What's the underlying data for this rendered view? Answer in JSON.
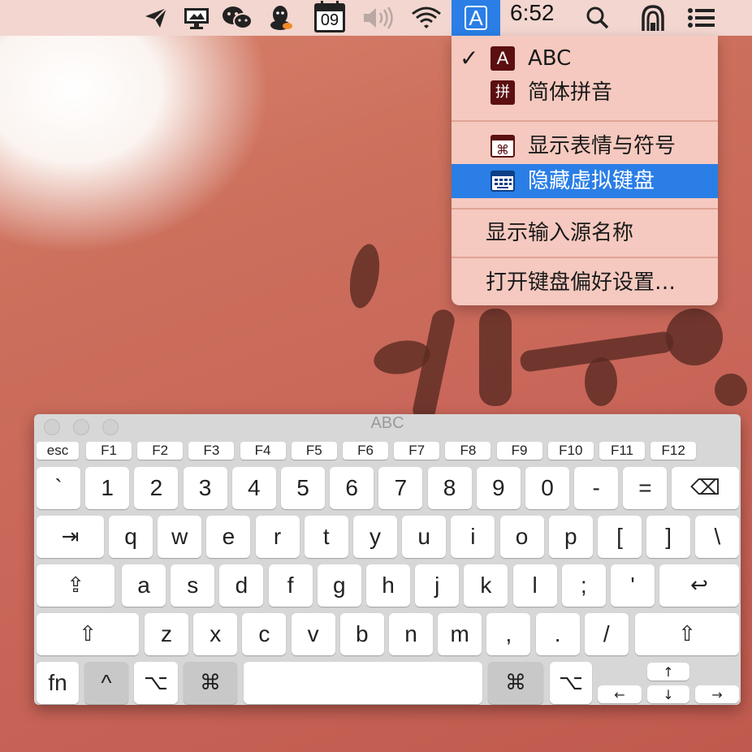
{
  "menubar": {
    "icons": [
      "paper-plane-icon",
      "remote-desktop-icon",
      "wechat-icon",
      "qq-icon",
      "calendar-icon",
      "volume-icon",
      "wifi-icon"
    ],
    "calendar_day": "09",
    "input_source_letter": "A",
    "time": "6:52",
    "right_icons": [
      "search-icon",
      "siri-icon",
      "notification-list-icon"
    ],
    "accent": "#2a7ee6"
  },
  "input_menu": {
    "sources": [
      {
        "label": "ABC",
        "badge": "A",
        "checked": true
      },
      {
        "label": "简体拼音",
        "badge": "拼",
        "checked": false
      }
    ],
    "show_emoji_label": "显示表情与符号",
    "hide_keyboard_label": "隐藏虚拟键盘",
    "show_input_name_label": "显示输入源名称",
    "open_prefs_label": "打开键盘偏好设置…"
  },
  "keyboard": {
    "title": "ABC",
    "fn_row": [
      "esc",
      "F1",
      "F2",
      "F3",
      "F4",
      "F5",
      "F6",
      "F7",
      "F8",
      "F9",
      "F10",
      "F11",
      "F12"
    ],
    "row1": [
      "`",
      "1",
      "2",
      "3",
      "4",
      "5",
      "6",
      "7",
      "8",
      "9",
      "0",
      "-",
      "=",
      "⌫"
    ],
    "row2": [
      "⇥",
      "q",
      "w",
      "e",
      "r",
      "t",
      "y",
      "u",
      "i",
      "o",
      "p",
      "[",
      "]",
      "\\"
    ],
    "row3": [
      "⇪",
      "a",
      "s",
      "d",
      "f",
      "g",
      "h",
      "j",
      "k",
      "l",
      ";",
      "'",
      "↩"
    ],
    "row4": [
      "⇧",
      "z",
      "x",
      "c",
      "v",
      "b",
      "n",
      "m",
      ",",
      ".",
      "/",
      "⇧"
    ],
    "row5": {
      "fn": "fn",
      "ctrl": "^",
      "opt": "⌥",
      "cmd": "⌘",
      "cmd_r": "⌘",
      "opt_r": "⌥"
    },
    "arrows": {
      "up": "↑",
      "left": "←",
      "down": "↓",
      "right": "→"
    }
  }
}
